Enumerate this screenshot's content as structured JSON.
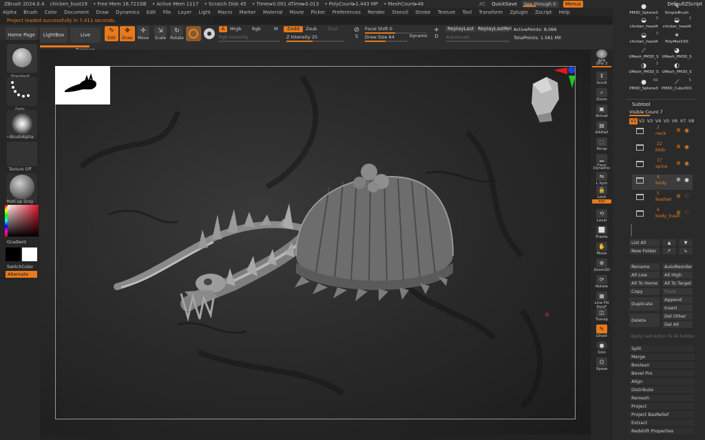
{
  "titlebar": {
    "app": "ZBrush 2024.0.4",
    "document": "chicken_bust19",
    "free_mem": "• Free Mem 16.721GB",
    "active_mem": "• Active Mem 1117",
    "scratch_disk": "• Scratch Disk 45",
    "timer": "• Timer▸0.001 ATime▸0.013",
    "polycount": "• PolyCount▸1.443 MP",
    "meshcount": "• MeshCount▸48",
    "ac": "AC",
    "quicksave": "QuickSave",
    "see_through": "See-through  0",
    "menus": "Menus",
    "default_zscript": "DefaultZScript"
  },
  "menubar": [
    "Alpha",
    "Brush",
    "Color",
    "Document",
    "Draw",
    "Dynamics",
    "Edit",
    "File",
    "Layer",
    "Light",
    "Macro",
    "Marker",
    "Material",
    "Movie",
    "Picker",
    "Preferences",
    "Render",
    "Stencil",
    "Stroke",
    "Texture",
    "Tool",
    "Transform",
    "Zplugin",
    "Zscript",
    "Help"
  ],
  "status_message": "Project loaded successfully in 7.411 seconds.",
  "toolbar": {
    "home_page": "Home Page",
    "lightbox": "LightBox",
    "live_boolean": "Live Boolean",
    "edit": "Edit",
    "draw": "Draw",
    "move": "Move",
    "scale": "Scale",
    "rotate": "Rotate",
    "a_label": "A",
    "mrgb": "Mrgb",
    "rgb": "Rgb",
    "m": "M",
    "zadd": "Zadd",
    "zsub": "Zsub",
    "zcut": "Zcut",
    "rgb_intensity": "Rgb Intensity",
    "z_intensity": "Z Intensity 25",
    "focal_shift": "Focal Shift 0",
    "draw_size": "Draw Size 64",
    "dynamic": "Dynamic",
    "s_label": "S",
    "replay_last": "ReplayLast",
    "replay_last_rel": "ReplayLastRel",
    "adjust_last": "AdjustLast",
    "d_label": "D",
    "active_points": "ActivePoints: 8,066",
    "total_points": "TotalPoints: 1.561 Mil"
  },
  "leftshelf": {
    "brush": "Standard",
    "stroke": "Dots",
    "alpha": "~BrushAlpha",
    "texture": "Texture Off",
    "material": "MatCap Gray",
    "gradient": "Gradient",
    "switch_color": "SwitchColor",
    "alternate": "Alternate"
  },
  "rightshelf": [
    "BPR",
    "SPix 3",
    "Scroll",
    "Zoom",
    "Actual",
    "AAHalf",
    "Persp",
    "Floor",
    "Dynamic",
    "L.Sym",
    "Lock",
    "xyz",
    "Local",
    "Frame",
    "Move",
    "Zoom3D",
    "Rotate",
    "Line Fill PolyF",
    "Transp",
    "Ghost",
    "Solo",
    "Xpose"
  ],
  "tray": {
    "tools": [
      {
        "name": "PM3D_Sphere3",
        "count": ""
      },
      {
        "name": "SimpleBrush",
        "count": ""
      },
      {
        "name": "chicken_head4",
        "count": "3"
      },
      {
        "name": "chicken_head4",
        "count": "3"
      },
      {
        "name": "chicken_head4",
        "count": "3"
      },
      {
        "name": "PolyMesh3D",
        "count": ""
      },
      {
        "name": "UMesh_PM3D_S",
        "count": ""
      },
      {
        "name": "UMesh_PM3D_S",
        "count": ""
      },
      {
        "name": "UMesh_PM3D_S",
        "count": "3"
      },
      {
        "name": "UMesh_PM3D_S",
        "count": ""
      },
      {
        "name": "PM3D_Sphere3",
        "count": "60"
      },
      {
        "name": "PM3D_Cube3D1",
        "count": "5"
      }
    ],
    "subtool_title": "Subtool",
    "visible_count": "Visible Count 7",
    "vtabs": [
      "V1",
      "V2",
      "V3",
      "V4",
      "V5",
      "V6",
      "V7",
      "V8"
    ],
    "subtools": [
      {
        "num": "2",
        "name": "neck"
      },
      {
        "num": "22",
        "name": "blob"
      },
      {
        "num": "17",
        "name": "spine"
      },
      {
        "num": "4",
        "name": "body"
      },
      {
        "num": "5",
        "name": "feather"
      },
      {
        "num": "6",
        "name": "body_trash"
      }
    ],
    "list_all": "List All",
    "new_folder": "New Folder",
    "rename": "Rename",
    "auto_reorder": "AutoReorder",
    "all_low": "All Low",
    "all_high": "All High",
    "all_to_home": "All To Home",
    "all_to_target": "All To Target",
    "copy": "Copy",
    "paste": "Paste",
    "duplicate": "Duplicate",
    "append": "Append",
    "insert": "Insert",
    "delete": "Delete",
    "del_other": "Del Other",
    "del_all": "Del All",
    "apply_last": "Apply Last Action To All Subtoo",
    "sections": [
      "Split",
      "Merge",
      "Boolean",
      "Bevel Pro",
      "Align",
      "Distribute",
      "Remesh",
      "Project",
      "Project BasRelief",
      "Extract",
      "Redshift Properties"
    ]
  },
  "colors": {
    "accent": "#e8791c",
    "panel": "#2a2a2a",
    "viewport": "#2a2a2a"
  }
}
